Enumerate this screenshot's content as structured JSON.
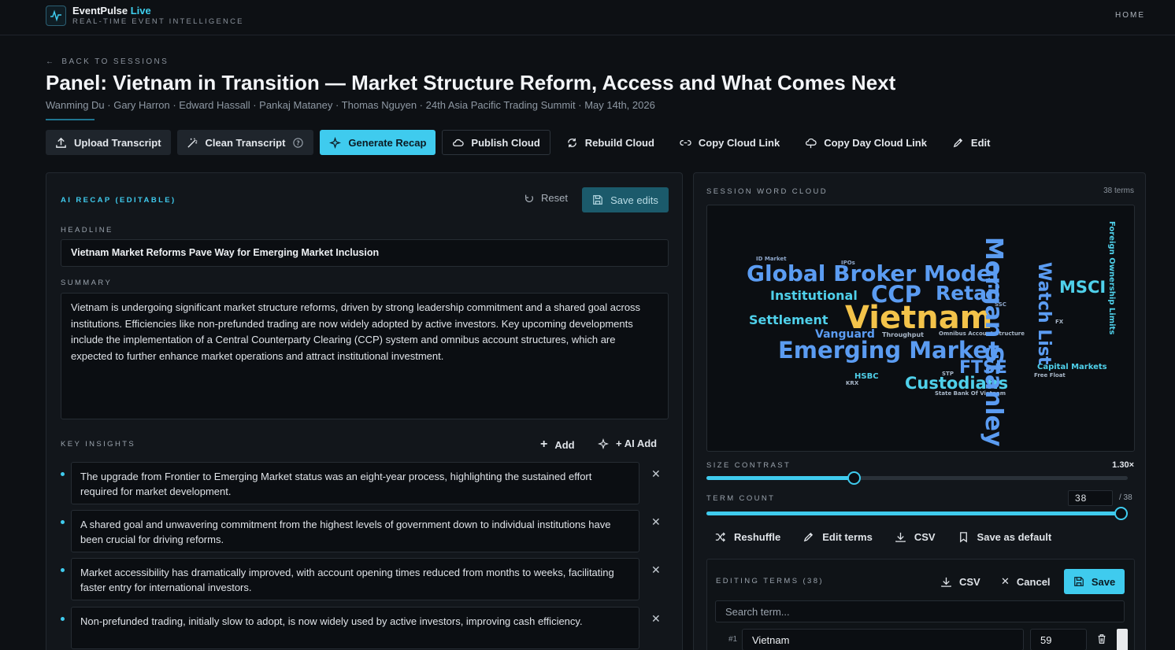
{
  "app": {
    "brand_name": "EventPulse",
    "brand_live": "Live",
    "tagline": "REAL-TIME EVENT INTELLIGENCE",
    "nav_home": "HOME"
  },
  "page": {
    "back_label": "BACK TO SESSIONS",
    "title": "Panel: Vietnam in Transition — Market Structure Reform, Access and What Comes Next",
    "meta": "Wanming Du · Gary Harron · Edward Hassall · Pankaj Mataney · Thomas Nguyen · 24th Asia Pacific Trading Summit · May 14th, 2026"
  },
  "toolbar": {
    "upload": "Upload Transcript",
    "clean": "Clean Transcript",
    "generate": "Generate Recap",
    "publish": "Publish Cloud",
    "rebuild": "Rebuild Cloud",
    "copy_link": "Copy Cloud Link",
    "copy_day": "Copy Day Cloud Link",
    "edit": "Edit"
  },
  "recap": {
    "label": "AI RECAP (EDITABLE)",
    "reset": "Reset",
    "save_edits": "Save edits",
    "headline_label": "HEADLINE",
    "headline": "Vietnam Market Reforms Pave Way for Emerging Market Inclusion",
    "summary_label": "SUMMARY",
    "summary": "Vietnam is undergoing significant market structure reforms, driven by strong leadership commitment and a shared goal across institutions. Efficiencies like non-prefunded trading are now widely adopted by active investors. Key upcoming developments include the implementation of a Central Counterparty Clearing (CCP) system and omnibus account structures, which are expected to further enhance market operations and attract institutional investment.",
    "insights_label": "KEY INSIGHTS",
    "add": "Add",
    "ai_add": "+ AI Add",
    "insights": [
      "The upgrade from Frontier to Emerging Market status was an eight-year process, highlighting the sustained effort required for market development.",
      "A shared goal and unwavering commitment from the highest levels of government down to individual institutions have been crucial for driving reforms.",
      "Market accessibility has dramatically improved, with account opening times reduced from months to weeks, facilitating faster entry for international investors.",
      "Non-prefunded trading, initially slow to adopt, is now widely used by active investors, improving cash efficiency."
    ]
  },
  "cloud": {
    "label": "SESSION WORD CLOUD",
    "terms_count": "38 terms",
    "size_contrast_label": "SIZE CONTRAST",
    "size_contrast_value": "1.30×",
    "size_contrast_fraction": 0.35,
    "term_count_label": "TERM COUNT",
    "term_count_value": "38",
    "term_count_max": "/ 38",
    "term_count_fraction": 1.0,
    "reshuffle": "Reshuffle",
    "edit_terms": "Edit terms",
    "csv": "CSV",
    "save_default": "Save as default",
    "words": {
      "global_broker_model": "Global Broker Model",
      "ccp": "CCP",
      "retail": "Retail",
      "vietnam": "Vietnam",
      "morgan_stanley": "Morgan Stanley",
      "watch_list": "Watch List",
      "msci": "MSCI",
      "foreign_ownership": "Foreign Ownership Limits",
      "institutional": "Institutional",
      "settlement": "Settlement",
      "vanguard": "Vanguard",
      "emerging_market": "Emerging Market",
      "ftse": "FTSE",
      "custodians": "Custodians",
      "hsbc": "HSBC",
      "capital_markets": "Capital Markets",
      "free_float": "Free Float",
      "krx": "KRX",
      "stp": "STP",
      "throughput": "Throughput",
      "omnibus": "Omnibus Account Structure",
      "state_bank": "State Bank Of Vietnam",
      "ssc": "SSC",
      "fx": "FX",
      "id_market": "ID Market",
      "ipos": "IPOs"
    }
  },
  "editing": {
    "label": "EDITING TERMS (38)",
    "csv": "CSV",
    "cancel": "Cancel",
    "save": "Save",
    "search_placeholder": "Search term...",
    "row_num": "#1",
    "row_term": "Vietnam",
    "row_weight": "59"
  },
  "colors": {
    "accent": "#3fcbee",
    "cloud_blue": "#5b9cf2",
    "cloud_yellow": "#f3c34a",
    "cloud_cyan": "#4fd0ea"
  }
}
